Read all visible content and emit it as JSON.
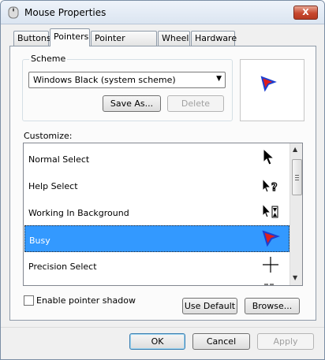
{
  "window": {
    "title": "Mouse Properties",
    "close_label": "X"
  },
  "tabs": [
    {
      "label": "Buttons",
      "active": false
    },
    {
      "label": "Pointers",
      "active": true
    },
    {
      "label": "Pointer Options",
      "active": false
    },
    {
      "label": "Wheel",
      "active": false
    },
    {
      "label": "Hardware",
      "active": false
    }
  ],
  "scheme": {
    "label": "Scheme",
    "selected": "Windows Black (system scheme)",
    "save_as_label": "Save As...",
    "delete_label": "Delete"
  },
  "customize": {
    "label": "Customize:",
    "items": [
      {
        "label": "Normal Select",
        "icon": "black-arrow-icon"
      },
      {
        "label": "Help Select",
        "icon": "help-arrow-icon"
      },
      {
        "label": "Working In Background",
        "icon": "working-arrow-icon"
      },
      {
        "label": "Busy",
        "icon": "busy-icon",
        "selected": true
      },
      {
        "label": "Precision Select",
        "icon": "crosshair-icon"
      }
    ]
  },
  "options": {
    "shadow_label": "Enable pointer shadow",
    "shadow_checked": false,
    "use_default_label": "Use Default",
    "browse_label": "Browse..."
  },
  "footer": {
    "ok_label": "OK",
    "cancel_label": "Cancel",
    "apply_label": "Apply"
  },
  "colors": {
    "selection": "#3399ff",
    "busy_red": "#e01e1e",
    "busy_blue": "#1c3fd1"
  }
}
